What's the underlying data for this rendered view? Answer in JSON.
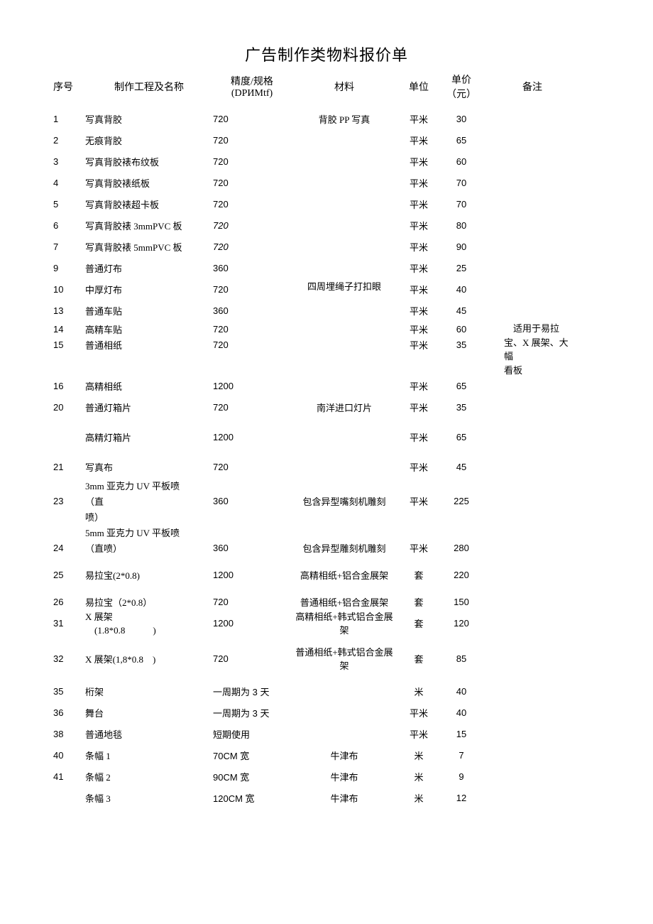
{
  "title": "广告制作类物料报价单",
  "headers": {
    "no": "序号",
    "name": "制作工程及名称",
    "spec_line1": "精度/规格",
    "spec_line2": "(DPИMtf)",
    "material": "材料",
    "unit": "单位",
    "price_line1": "单价",
    "price_line2": "（元）",
    "remark": "备注"
  },
  "rows": [
    {
      "no": "1",
      "name": "写真背胶",
      "spec": "720",
      "material": "背胶 PP 写真",
      "unit": "平米",
      "price": "30",
      "remark": ""
    },
    {
      "no": "2",
      "name": "无痕背胶",
      "spec": "720",
      "material": "",
      "unit": "平米",
      "price": "65",
      "remark": ""
    },
    {
      "no": "3",
      "name": "写真背胶裱布纹板",
      "spec": "720",
      "material": "",
      "unit": "平米",
      "price": "60",
      "remark": ""
    },
    {
      "no": "4",
      "name": "写真背胶裱纸板",
      "spec": "720",
      "material": "",
      "unit": "平米",
      "price": "70",
      "remark": ""
    },
    {
      "no": "5",
      "name": "写真背胶裱超卡板",
      "spec": "720",
      "material": "",
      "unit": "平米",
      "price": "70",
      "remark": ""
    },
    {
      "no": "6",
      "name": "写真背胶裱 3mmPVC 板",
      "spec": "720",
      "spec_italic": true,
      "material": "",
      "unit": "平米",
      "price": "80",
      "remark": ""
    },
    {
      "no": "7",
      "name": "写真背胶裱 5mmPVC 板",
      "spec": "720",
      "spec_italic": true,
      "material": "",
      "unit": "平米",
      "price": "90",
      "remark": ""
    },
    {
      "no": "9",
      "name": "普通灯布",
      "spec": "360",
      "material": "",
      "unit": "平米",
      "price": "25",
      "remark": "",
      "material_rowspan_top": true
    },
    {
      "no": "10",
      "name": "中厚灯布",
      "spec": "720",
      "material": "四周埋绳子打扣眼",
      "unit": "平米",
      "price": "40",
      "remark": "",
      "material_between": true
    },
    {
      "no": "13",
      "name": "普通车贴",
      "spec": "360",
      "material": "",
      "unit": "平米",
      "price": "45",
      "remark": ""
    },
    {
      "no": "14",
      "name": "高精车贴",
      "spec": "720",
      "material": "",
      "unit": "平米",
      "price": "60",
      "remark": "",
      "tight": true
    },
    {
      "no": "15",
      "name": "普通相纸",
      "spec": "720",
      "material": "",
      "unit": "平米",
      "price": "35",
      "remark": "",
      "tight": true
    },
    {
      "no": "16",
      "name": "高精相纸",
      "spec": "1200",
      "material": "",
      "unit": "平米",
      "price": "65",
      "remark": "",
      "gap_before": true
    },
    {
      "no": "20",
      "name": "普通灯箱片",
      "spec": "720",
      "material": "南洋进口灯片",
      "unit": "平米",
      "price": "35",
      "remark": ""
    },
    {
      "no": "",
      "name": "高精灯箱片",
      "spec": "1200",
      "material": "",
      "unit": "平米",
      "price": "65",
      "remark": "",
      "gap_before_small": true
    },
    {
      "no": "21",
      "name": "写真布",
      "spec": "720",
      "material": "",
      "unit": "平米",
      "price": "45",
      "remark": "",
      "gap_before_small": true
    },
    {
      "no": "",
      "name": "3mm 亚克力 UV 平板喷",
      "spec": "",
      "material": "",
      "unit": "",
      "price": "",
      "remark": "",
      "tight": true
    },
    {
      "no": "23",
      "name": "（直",
      "spec": "360",
      "material": "包含异型嘴刻机雕刻",
      "unit": "平米",
      "price": "225",
      "remark": "",
      "tight": true
    },
    {
      "no": "",
      "name": "喷）",
      "spec": "",
      "material": "",
      "unit": "",
      "price": "",
      "remark": "",
      "tight": true
    },
    {
      "no": "",
      "name": "5mm 亚克力 UV 平板喷",
      "spec": "",
      "material": "",
      "unit": "",
      "price": "",
      "remark": "",
      "tight": true
    },
    {
      "no": "24",
      "name": "（直喷）",
      "spec": "360",
      "material": "包含异型雕刻机雕刻",
      "unit": "平米",
      "price": "280",
      "remark": "",
      "tight": true
    },
    {
      "no": "25",
      "name": "易拉宝(2*0.8)",
      "spec": "1200",
      "material": "高精相纸+铝合金展架",
      "unit": "套",
      "price": "220",
      "remark": "",
      "gap_before_small": true
    },
    {
      "no": "26",
      "name": "易拉宝（2*0.8）",
      "spec": "720",
      "material": "普通相纸+铝合金展架",
      "unit": "套",
      "price": "150",
      "remark": "",
      "tight": true,
      "gap_before_small": true
    },
    {
      "no": "31",
      "name_line1": "X 展架",
      "name_line2": "　(1.8*0.8　　　)",
      "spec": "1200",
      "material": "高精相纸+韩式铝合金展架",
      "unit": "套",
      "price": "120",
      "remark": "",
      "tight": true,
      "multiline": true
    },
    {
      "no": "32",
      "name_line1": "X 展架(1,8*0.8　)",
      "name_line2": "",
      "spec": "720",
      "material": "普通相纸+韩式铝合金展架",
      "unit": "套",
      "price": "85",
      "remark": "",
      "multiline": true,
      "gap_before_small": true
    },
    {
      "no": "35",
      "name": "桁架",
      "spec": "一周期为 3 天",
      "material": "",
      "unit": "米",
      "price": "40",
      "remark": "",
      "gap_before_small": true
    },
    {
      "no": "36",
      "name": "舞台",
      "spec": "一周期为 3 天",
      "material": "",
      "unit": "平米",
      "price": "40",
      "remark": ""
    },
    {
      "no": "38",
      "name": "普通地毯",
      "spec": "短期使用",
      "material": "",
      "unit": "平米",
      "price": "15",
      "remark": ""
    },
    {
      "no": "40",
      "name": "条幅 1",
      "spec": "70CM 宽",
      "material": "牛津布",
      "unit": "米",
      "price": "7",
      "remark": ""
    },
    {
      "no": "41",
      "name": "条幅 2",
      "spec": "90CM 宽",
      "material": "牛津布",
      "unit": "米",
      "price": "9",
      "remark": ""
    },
    {
      "no": "",
      "name": "条幅 3",
      "spec": "120CM 宽",
      "material": "牛津布",
      "unit": "米",
      "price": "12",
      "remark": ""
    }
  ],
  "remark_float": {
    "line1": "适用于易拉",
    "line2": "宝、X 展架、大",
    "line3": "幅",
    "line4": "看板"
  },
  "material_merged": "四周埋绳子打扣眼"
}
